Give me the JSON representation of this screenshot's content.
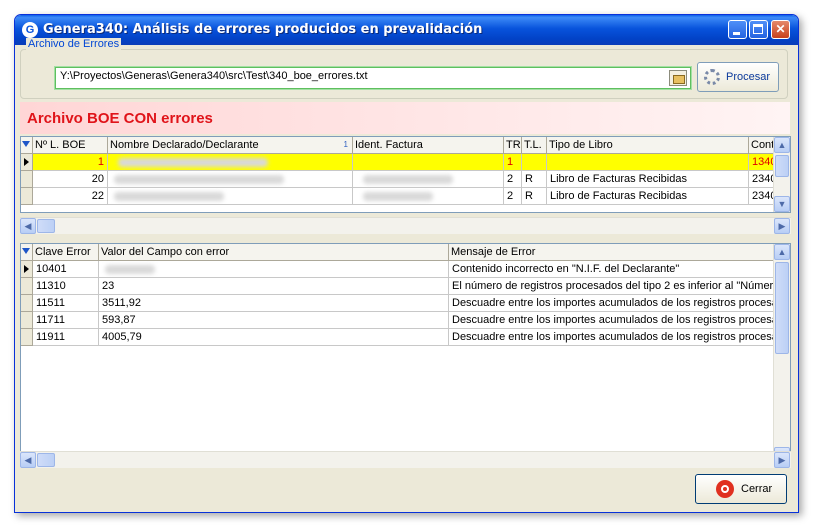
{
  "window": {
    "title": "Genera340: Análisis de errores producidos en prevalidación",
    "icon_name": "app-icon",
    "minimize_icon": "minimize-icon",
    "maximize_icon": "maximize-icon",
    "close_icon": "close-icon"
  },
  "file_group": {
    "label": "Archivo de Errores",
    "path_value": "Y:\\Proyectos\\Generas\\Genera340\\src\\Test\\340_boe_errores.txt",
    "browse_icon": "folder-open-icon",
    "process_label": "Procesar",
    "process_icon": "gears-icon"
  },
  "status_banner": {
    "text": "Archivo BOE CON errores",
    "color": "#e0141a"
  },
  "records_grid": {
    "columns": [
      "Nº L. BOE",
      "Nombre Declarado/Declarante",
      "Ident. Factura",
      "TR",
      "T.L.",
      "Tipo de Libro",
      "Cont"
    ],
    "sort_indicator": "1",
    "rows": [
      {
        "num": "1",
        "nombre": "",
        "ident": "",
        "tr": "1",
        "tl": "",
        "tipo": "",
        "cont": "1340",
        "selected": true
      },
      {
        "num": "20",
        "nombre": "",
        "ident": "",
        "tr": "2",
        "tl": "R",
        "tipo": "Libro de Facturas Recibidas",
        "cont": "2340",
        "selected": false
      },
      {
        "num": "22",
        "nombre": "",
        "ident": "",
        "tr": "2",
        "tl": "R",
        "tipo": "Libro de Facturas Recibidas",
        "cont": "2340",
        "selected": false
      }
    ]
  },
  "errors_grid": {
    "columns": [
      "Clave Error",
      "Valor del Campo con error",
      "Mensaje de Error"
    ],
    "rows": [
      {
        "clave": "10401",
        "valor": "",
        "mensaje": "Contenido incorrecto en \"N.I.F. del Declarante\""
      },
      {
        "clave": "11310",
        "valor": "23",
        "mensaje": "El número de registros procesados del tipo 2 es inferior al \"Número T"
      },
      {
        "clave": "11511",
        "valor": "3511,92",
        "mensaje": "Descuadre entre los importes acumulados de los registros procesado"
      },
      {
        "clave": "11711",
        "valor": "593,87",
        "mensaje": "Descuadre entre los importes acumulados de los registros procesado"
      },
      {
        "clave": "11911",
        "valor": "4005,79",
        "mensaje": "Descuadre entre los importes acumulados de los registros procesado"
      }
    ]
  },
  "footer": {
    "close_label": "Cerrar",
    "close_icon": "power-icon"
  }
}
